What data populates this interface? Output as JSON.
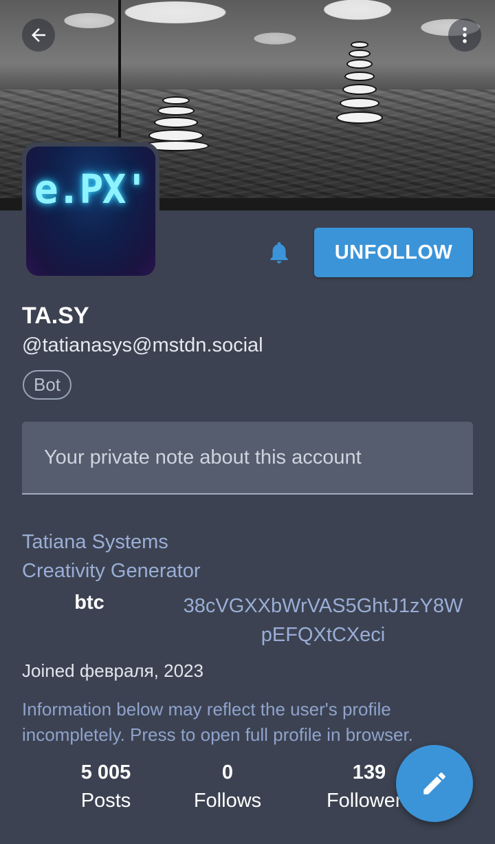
{
  "header": {
    "back_icon": "arrow-left-icon",
    "menu_icon": "more-vertical-icon"
  },
  "profile": {
    "avatar_text": "e.PX'",
    "display_name": "TA.SY",
    "handle": "@tatianasys@mstdn.social",
    "bot_badge": "Bot",
    "note_placeholder": "Your private note about this account",
    "bio_line1": "Tatiana Systems",
    "bio_line2": "Creativity Generator",
    "field_name": "btc",
    "field_value": "38cVGXXbWrVAS5GhtJ1zY8WpEFQXtCXeci",
    "joined": "Joined февраля, 2023",
    "info_note": "Information below may reflect the user's profile incompletely. Press to open full profile in browser."
  },
  "actions": {
    "notify_icon": "bell-icon",
    "unfollow_label": "UNFOLLOW",
    "compose_icon": "pencil-icon"
  },
  "stats": [
    {
      "value": "5 005",
      "label": "Posts"
    },
    {
      "value": "0",
      "label": "Follows"
    },
    {
      "value": "139",
      "label": "Followers"
    }
  ],
  "colors": {
    "background": "#3c4251",
    "accent": "#3c94d8",
    "link": "#9aaed6"
  }
}
